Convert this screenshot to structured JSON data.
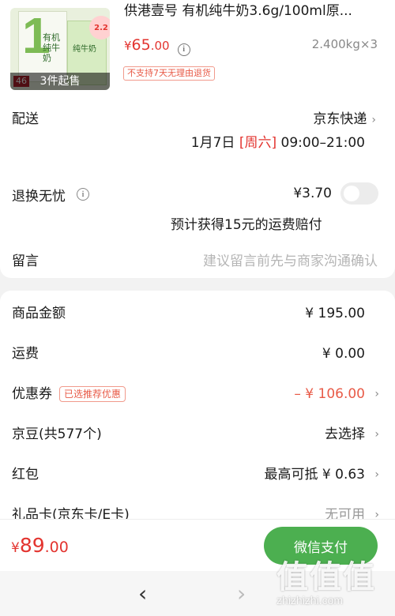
{
  "product": {
    "title": "供港壹号 有机纯牛奶3.6g/100ml原...",
    "min_quantity": "3件起售",
    "badge_46": "46",
    "badge_22": "2.2",
    "price_currency": "¥",
    "price_main": "65",
    "price_cents": ".00",
    "weight": "2.400kg×3",
    "no_return_tag": "不支持7天无理由退货",
    "package_text_a": "有机纯牛奶",
    "package_text_b": "纯牛奶"
  },
  "delivery": {
    "label": "配送",
    "carrier": "京东快递",
    "date": "1月7日",
    "weekday": "[周六]",
    "time": "09:00–21:00"
  },
  "return_insurance": {
    "label": "退换无忧",
    "price": "¥3.70",
    "enabled": false,
    "note": "预计获得15元的运费赔付"
  },
  "message": {
    "label": "留言",
    "placeholder": "建议留言前先与商家沟通确认"
  },
  "summary": {
    "goods_amount_label": "商品金额",
    "goods_amount": "¥ 195.00",
    "shipping_label": "运费",
    "shipping": "¥ 0.00",
    "coupon_label": "优惠券",
    "coupon_badge": "已选推荐优惠",
    "coupon_value": "– ¥ 106.00",
    "jingdou_label": "京豆(共577个)",
    "jingdou_value": "去选择",
    "redpacket_label": "红包",
    "redpacket_value": "最高可抵 ¥ 0.63",
    "giftcard_label": "礼品卡(京东卡/E卡)",
    "giftcard_value": "无可用"
  },
  "checkout": {
    "total_currency": "¥",
    "total_main": "89",
    "total_cents": ".00",
    "pay_label": "微信支付"
  },
  "watermark": {
    "chars": "值值值",
    "url": "zhizhizhi.com"
  },
  "colors": {
    "price_red": "#e3342f",
    "pay_green": "#4caf50"
  }
}
